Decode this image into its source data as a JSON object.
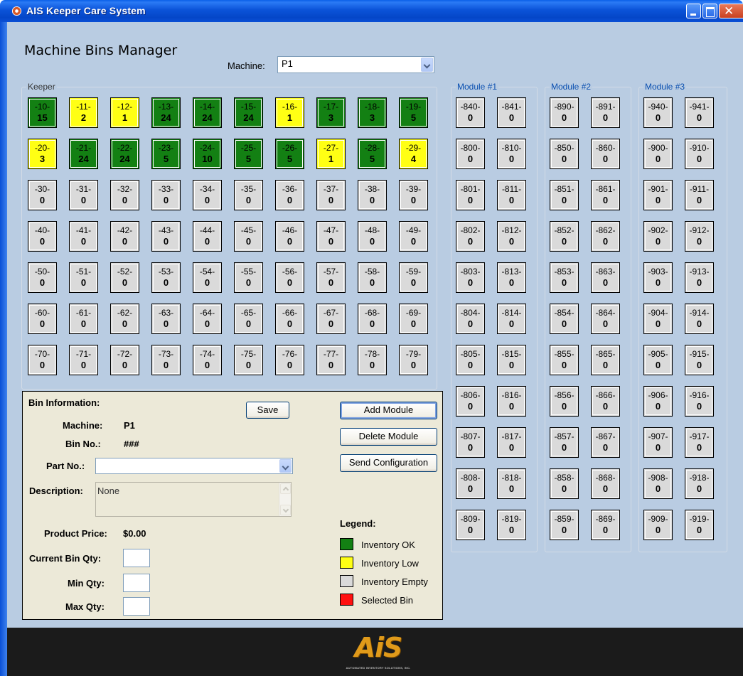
{
  "window": {
    "title": "AIS Keeper Care System"
  },
  "page": {
    "title": "Machine Bins Manager",
    "machine_label": "Machine:",
    "machine_value": "P1"
  },
  "keeper": {
    "label": "Keeper",
    "bins": [
      {
        "num": "-10-",
        "qty": "15",
        "status": "ok"
      },
      {
        "num": "-11-",
        "qty": "2",
        "status": "low"
      },
      {
        "num": "-12-",
        "qty": "1",
        "status": "low"
      },
      {
        "num": "-13-",
        "qty": "24",
        "status": "ok"
      },
      {
        "num": "-14-",
        "qty": "24",
        "status": "ok"
      },
      {
        "num": "-15-",
        "qty": "24",
        "status": "ok"
      },
      {
        "num": "-16-",
        "qty": "1",
        "status": "low"
      },
      {
        "num": "-17-",
        "qty": "3",
        "status": "ok"
      },
      {
        "num": "-18-",
        "qty": "3",
        "status": "ok"
      },
      {
        "num": "-19-",
        "qty": "5",
        "status": "ok"
      },
      {
        "num": "-20-",
        "qty": "3",
        "status": "low"
      },
      {
        "num": "-21-",
        "qty": "24",
        "status": "ok"
      },
      {
        "num": "-22-",
        "qty": "24",
        "status": "ok"
      },
      {
        "num": "-23-",
        "qty": "5",
        "status": "ok"
      },
      {
        "num": "-24-",
        "qty": "10",
        "status": "ok"
      },
      {
        "num": "-25-",
        "qty": "5",
        "status": "ok"
      },
      {
        "num": "-26-",
        "qty": "5",
        "status": "ok"
      },
      {
        "num": "-27-",
        "qty": "1",
        "status": "low"
      },
      {
        "num": "-28-",
        "qty": "5",
        "status": "ok"
      },
      {
        "num": "-29-",
        "qty": "4",
        "status": "low"
      },
      {
        "num": "-30-",
        "qty": "0",
        "status": "empty"
      },
      {
        "num": "-31-",
        "qty": "0",
        "status": "empty"
      },
      {
        "num": "-32-",
        "qty": "0",
        "status": "empty"
      },
      {
        "num": "-33-",
        "qty": "0",
        "status": "empty"
      },
      {
        "num": "-34-",
        "qty": "0",
        "status": "empty"
      },
      {
        "num": "-35-",
        "qty": "0",
        "status": "empty"
      },
      {
        "num": "-36-",
        "qty": "0",
        "status": "empty"
      },
      {
        "num": "-37-",
        "qty": "0",
        "status": "empty"
      },
      {
        "num": "-38-",
        "qty": "0",
        "status": "empty"
      },
      {
        "num": "-39-",
        "qty": "0",
        "status": "empty"
      },
      {
        "num": "-40-",
        "qty": "0",
        "status": "empty"
      },
      {
        "num": "-41-",
        "qty": "0",
        "status": "empty"
      },
      {
        "num": "-42-",
        "qty": "0",
        "status": "empty"
      },
      {
        "num": "-43-",
        "qty": "0",
        "status": "empty"
      },
      {
        "num": "-44-",
        "qty": "0",
        "status": "empty"
      },
      {
        "num": "-45-",
        "qty": "0",
        "status": "empty"
      },
      {
        "num": "-46-",
        "qty": "0",
        "status": "empty"
      },
      {
        "num": "-47-",
        "qty": "0",
        "status": "empty"
      },
      {
        "num": "-48-",
        "qty": "0",
        "status": "empty"
      },
      {
        "num": "-49-",
        "qty": "0",
        "status": "empty"
      },
      {
        "num": "-50-",
        "qty": "0",
        "status": "empty"
      },
      {
        "num": "-51-",
        "qty": "0",
        "status": "empty"
      },
      {
        "num": "-52-",
        "qty": "0",
        "status": "empty"
      },
      {
        "num": "-53-",
        "qty": "0",
        "status": "empty"
      },
      {
        "num": "-54-",
        "qty": "0",
        "status": "empty"
      },
      {
        "num": "-55-",
        "qty": "0",
        "status": "empty"
      },
      {
        "num": "-56-",
        "qty": "0",
        "status": "empty"
      },
      {
        "num": "-57-",
        "qty": "0",
        "status": "empty"
      },
      {
        "num": "-58-",
        "qty": "0",
        "status": "empty"
      },
      {
        "num": "-59-",
        "qty": "0",
        "status": "empty"
      },
      {
        "num": "-60-",
        "qty": "0",
        "status": "empty"
      },
      {
        "num": "-61-",
        "qty": "0",
        "status": "empty"
      },
      {
        "num": "-62-",
        "qty": "0",
        "status": "empty"
      },
      {
        "num": "-63-",
        "qty": "0",
        "status": "empty"
      },
      {
        "num": "-64-",
        "qty": "0",
        "status": "empty"
      },
      {
        "num": "-65-",
        "qty": "0",
        "status": "empty"
      },
      {
        "num": "-66-",
        "qty": "0",
        "status": "empty"
      },
      {
        "num": "-67-",
        "qty": "0",
        "status": "empty"
      },
      {
        "num": "-68-",
        "qty": "0",
        "status": "empty"
      },
      {
        "num": "-69-",
        "qty": "0",
        "status": "empty"
      },
      {
        "num": "-70-",
        "qty": "0",
        "status": "empty"
      },
      {
        "num": "-71-",
        "qty": "0",
        "status": "empty"
      },
      {
        "num": "-72-",
        "qty": "0",
        "status": "empty"
      },
      {
        "num": "-73-",
        "qty": "0",
        "status": "empty"
      },
      {
        "num": "-74-",
        "qty": "0",
        "status": "empty"
      },
      {
        "num": "-75-",
        "qty": "0",
        "status": "empty"
      },
      {
        "num": "-76-",
        "qty": "0",
        "status": "empty"
      },
      {
        "num": "-77-",
        "qty": "0",
        "status": "empty"
      },
      {
        "num": "-78-",
        "qty": "0",
        "status": "empty"
      },
      {
        "num": "-79-",
        "qty": "0",
        "status": "empty"
      }
    ]
  },
  "modules": [
    {
      "label": "Module #1",
      "bins": [
        {
          "num": "-840-",
          "qty": "0",
          "status": "empty"
        },
        {
          "num": "-841-",
          "qty": "0",
          "status": "empty"
        },
        {
          "num": "-800-",
          "qty": "0",
          "status": "empty"
        },
        {
          "num": "-810-",
          "qty": "0",
          "status": "empty"
        },
        {
          "num": "-801-",
          "qty": "0",
          "status": "empty"
        },
        {
          "num": "-811-",
          "qty": "0",
          "status": "empty"
        },
        {
          "num": "-802-",
          "qty": "0",
          "status": "empty"
        },
        {
          "num": "-812-",
          "qty": "0",
          "status": "empty"
        },
        {
          "num": "-803-",
          "qty": "0",
          "status": "empty"
        },
        {
          "num": "-813-",
          "qty": "0",
          "status": "empty"
        },
        {
          "num": "-804-",
          "qty": "0",
          "status": "empty"
        },
        {
          "num": "-814-",
          "qty": "0",
          "status": "empty"
        },
        {
          "num": "-805-",
          "qty": "0",
          "status": "empty"
        },
        {
          "num": "-815-",
          "qty": "0",
          "status": "empty"
        },
        {
          "num": "-806-",
          "qty": "0",
          "status": "empty"
        },
        {
          "num": "-816-",
          "qty": "0",
          "status": "empty"
        },
        {
          "num": "-807-",
          "qty": "0",
          "status": "empty"
        },
        {
          "num": "-817-",
          "qty": "0",
          "status": "empty"
        },
        {
          "num": "-808-",
          "qty": "0",
          "status": "empty"
        },
        {
          "num": "-818-",
          "qty": "0",
          "status": "empty"
        },
        {
          "num": "-809-",
          "qty": "0",
          "status": "empty"
        },
        {
          "num": "-819-",
          "qty": "0",
          "status": "empty"
        }
      ]
    },
    {
      "label": "Module #2",
      "bins": [
        {
          "num": "-890-",
          "qty": "0",
          "status": "empty"
        },
        {
          "num": "-891-",
          "qty": "0",
          "status": "empty"
        },
        {
          "num": "-850-",
          "qty": "0",
          "status": "empty"
        },
        {
          "num": "-860-",
          "qty": "0",
          "status": "empty"
        },
        {
          "num": "-851-",
          "qty": "0",
          "status": "empty"
        },
        {
          "num": "-861-",
          "qty": "0",
          "status": "empty"
        },
        {
          "num": "-852-",
          "qty": "0",
          "status": "empty"
        },
        {
          "num": "-862-",
          "qty": "0",
          "status": "empty"
        },
        {
          "num": "-853-",
          "qty": "0",
          "status": "empty"
        },
        {
          "num": "-863-",
          "qty": "0",
          "status": "empty"
        },
        {
          "num": "-854-",
          "qty": "0",
          "status": "empty"
        },
        {
          "num": "-864-",
          "qty": "0",
          "status": "empty"
        },
        {
          "num": "-855-",
          "qty": "0",
          "status": "empty"
        },
        {
          "num": "-865-",
          "qty": "0",
          "status": "empty"
        },
        {
          "num": "-856-",
          "qty": "0",
          "status": "empty"
        },
        {
          "num": "-866-",
          "qty": "0",
          "status": "empty"
        },
        {
          "num": "-857-",
          "qty": "0",
          "status": "empty"
        },
        {
          "num": "-867-",
          "qty": "0",
          "status": "empty"
        },
        {
          "num": "-858-",
          "qty": "0",
          "status": "empty"
        },
        {
          "num": "-868-",
          "qty": "0",
          "status": "empty"
        },
        {
          "num": "-859-",
          "qty": "0",
          "status": "empty"
        },
        {
          "num": "-869-",
          "qty": "0",
          "status": "empty"
        }
      ]
    },
    {
      "label": "Module #3",
      "bins": [
        {
          "num": "-940-",
          "qty": "0",
          "status": "empty"
        },
        {
          "num": "-941-",
          "qty": "0",
          "status": "empty"
        },
        {
          "num": "-900-",
          "qty": "0",
          "status": "empty"
        },
        {
          "num": "-910-",
          "qty": "0",
          "status": "empty"
        },
        {
          "num": "-901-",
          "qty": "0",
          "status": "empty"
        },
        {
          "num": "-911-",
          "qty": "0",
          "status": "empty"
        },
        {
          "num": "-902-",
          "qty": "0",
          "status": "empty"
        },
        {
          "num": "-912-",
          "qty": "0",
          "status": "empty"
        },
        {
          "num": "-903-",
          "qty": "0",
          "status": "empty"
        },
        {
          "num": "-913-",
          "qty": "0",
          "status": "empty"
        },
        {
          "num": "-904-",
          "qty": "0",
          "status": "empty"
        },
        {
          "num": "-914-",
          "qty": "0",
          "status": "empty"
        },
        {
          "num": "-905-",
          "qty": "0",
          "status": "empty"
        },
        {
          "num": "-915-",
          "qty": "0",
          "status": "empty"
        },
        {
          "num": "-906-",
          "qty": "0",
          "status": "empty"
        },
        {
          "num": "-916-",
          "qty": "0",
          "status": "empty"
        },
        {
          "num": "-907-",
          "qty": "0",
          "status": "empty"
        },
        {
          "num": "-917-",
          "qty": "0",
          "status": "empty"
        },
        {
          "num": "-908-",
          "qty": "0",
          "status": "empty"
        },
        {
          "num": "-918-",
          "qty": "0",
          "status": "empty"
        },
        {
          "num": "-909-",
          "qty": "0",
          "status": "empty"
        },
        {
          "num": "-919-",
          "qty": "0",
          "status": "empty"
        }
      ]
    }
  ],
  "bin_info": {
    "title": "Bin Information:",
    "machine_label": "Machine:",
    "machine_value": "P1",
    "bin_no_label": "Bin No.:",
    "bin_no_value": "###",
    "part_no_label": "Part No.:",
    "part_no_value": "",
    "description_label": "Description:",
    "description_value": "None",
    "price_label": "Product Price:",
    "price_value": "$0.00",
    "current_qty_label": "Current Bin Qty:",
    "current_qty_value": "",
    "min_qty_label": "Min Qty:",
    "min_qty_value": "",
    "max_qty_label": "Max Qty:",
    "max_qty_value": "",
    "save_label": "Save",
    "add_module_label": "Add Module",
    "delete_module_label": "Delete Module",
    "send_config_label": "Send Configuration"
  },
  "legend": {
    "title": "Legend:",
    "items": [
      {
        "label": "Inventory OK",
        "color": "#138013"
      },
      {
        "label": "Inventory Low",
        "color": "#ffff14"
      },
      {
        "label": "Inventory Empty",
        "color": "#dadada"
      },
      {
        "label": "Selected Bin",
        "color": "#ff1010"
      }
    ]
  },
  "footer": {
    "logo_text": "AiS",
    "logo_tagline": "AUTOMATED INVENTORY SOLUTIONS, INC."
  },
  "icons": {
    "app": "gear-icon",
    "minimize": "minimize-icon",
    "maximize": "maximize-icon",
    "close": "close-icon",
    "dropdown": "chevron-down-icon"
  }
}
